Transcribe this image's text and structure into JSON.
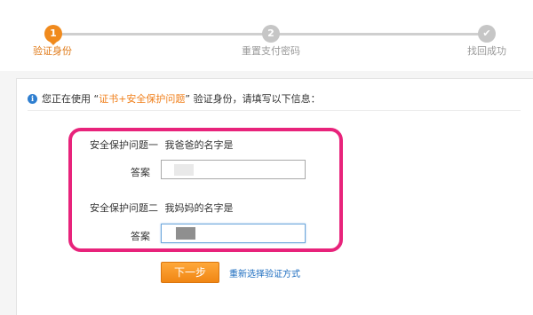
{
  "stepper": {
    "steps": [
      {
        "number": "1",
        "label": "验证身份"
      },
      {
        "number": "2",
        "label": "重置支付密码"
      },
      {
        "number": "✔",
        "label": "找回成功"
      }
    ]
  },
  "notice": {
    "prefix": "您正在使用 “",
    "method": "证书+安全保护问题",
    "suffix": "” 验证身份，请填写以下信息："
  },
  "form": {
    "q1": {
      "label": "安全保护问题一",
      "question": "我爸爸的名字是",
      "answer_label": "答案"
    },
    "q2": {
      "label": "安全保护问题二",
      "question": "我妈妈的名字是",
      "answer_label": "答案"
    }
  },
  "actions": {
    "next_label": "下一步",
    "reselect_label": "重新选择验证方式"
  },
  "colors": {
    "accent": "#f08a1d",
    "highlight": "#e8237b",
    "link": "#1a6bbf"
  }
}
